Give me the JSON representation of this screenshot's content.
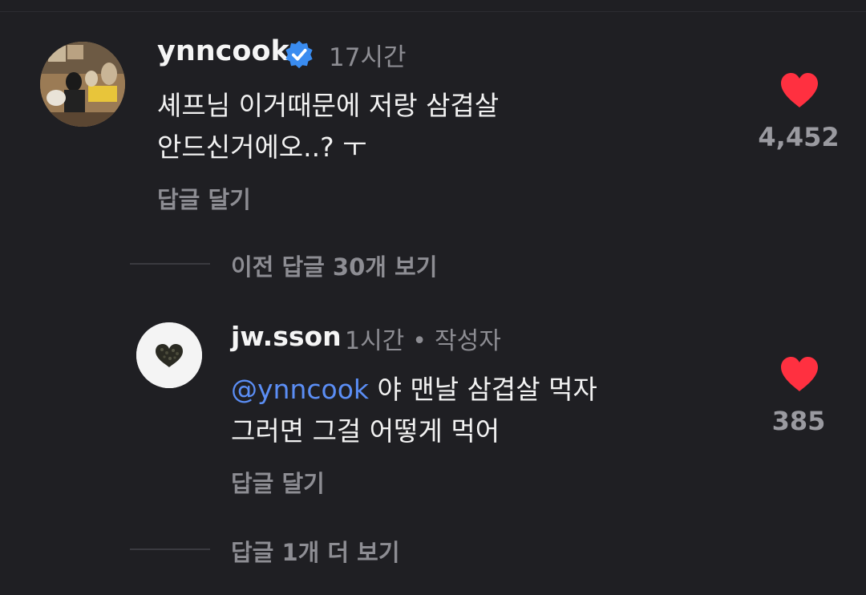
{
  "colors": {
    "background": "#1f1f23",
    "text": "#f2f2f2",
    "muted": "#8d8d93",
    "heart": "#ff3040",
    "mention": "#5b8ef5",
    "verified": "#3a8cf0"
  },
  "comment_1": {
    "username": "ynncook",
    "verified_icon": "verified-badge-icon",
    "time": "17시간",
    "text_line1": "셰프님 이거때문에 저랑 삼겹살",
    "text_line2": "안드신거에오..? ㅜ",
    "reply_label": "답글 달기",
    "liked": true,
    "like_count": "4,452"
  },
  "view_previous_replies": "이전 답글 30개 보기",
  "comment_2": {
    "username": "jw.sson",
    "time": "1시간",
    "separator": "•",
    "author_badge": "작성자",
    "mention": "@ynncook",
    "text_line1_rest": " 야 맨날 삼겹살 먹자",
    "text_line2": "그러면 그걸 어떻게 먹어",
    "reply_label": "답글 달기",
    "liked": true,
    "like_count": "385"
  },
  "view_more_replies": "답글 1개 더 보기"
}
